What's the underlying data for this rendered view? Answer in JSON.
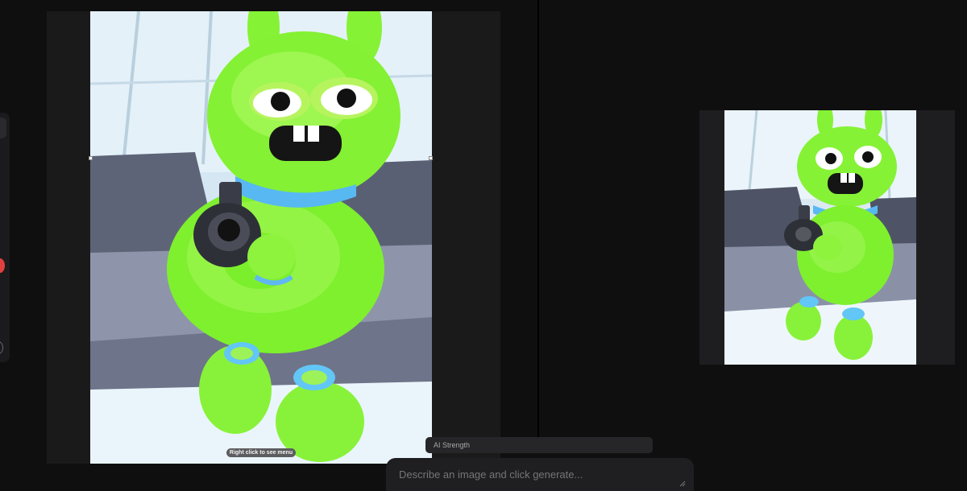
{
  "canvas": {
    "hint": "Right click to see menu"
  },
  "controls": {
    "ai_strength_label": "AI Strength",
    "prompt_placeholder": "Describe an image and click generate..."
  },
  "icons": {
    "record": "record-dot-icon",
    "resize": "resize-grip-icon"
  },
  "colors": {
    "background": "#0f0f10",
    "panel": "#1f1f21",
    "record_red": "#e0413f",
    "character_green": "#8cf53a"
  }
}
